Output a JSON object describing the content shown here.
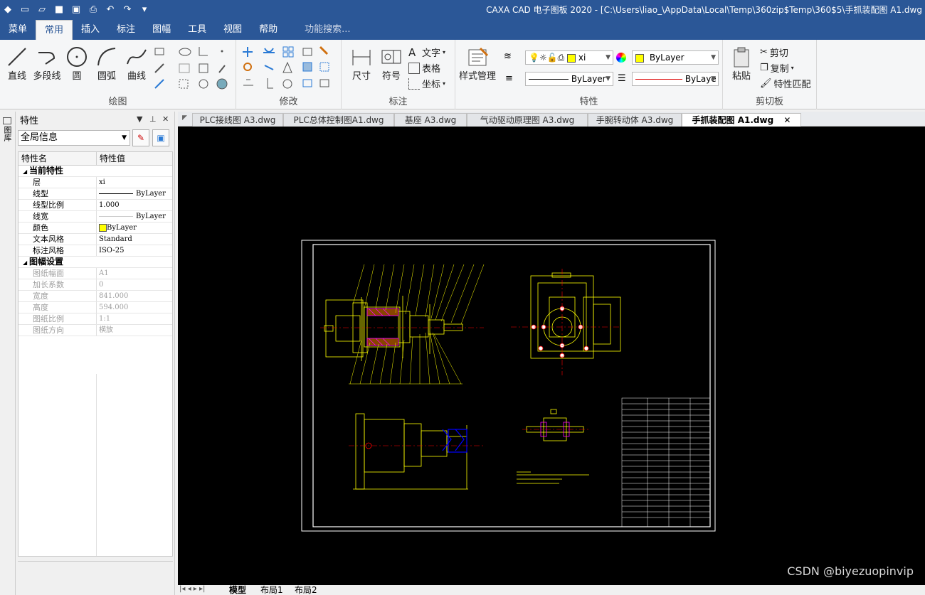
{
  "app": {
    "title": "CAXA CAD 电子图板 2020 - [C:\\Users\\liao_\\AppData\\Local\\Temp\\360zip$Temp\\360$5\\手抓装配图 A1.dwg"
  },
  "menubar": {
    "tabs": [
      "菜单",
      "常用",
      "插入",
      "标注",
      "图幅",
      "工具",
      "视图",
      "帮助"
    ],
    "active_index": 1,
    "search": "功能搜索..."
  },
  "ribbon": {
    "draw": {
      "label": "绘图",
      "line": "直线",
      "polyline": "多段线",
      "circle": "圆",
      "arc": "圆弧",
      "curve": "曲线"
    },
    "modify": {
      "label": "修改"
    },
    "annotate": {
      "label": "标注",
      "dimension": "尺寸",
      "symbol": "符号",
      "text": "文字",
      "table": "表格",
      "coord": "坐标"
    },
    "style": {
      "manager": "样式管理"
    },
    "properties": {
      "label": "特性",
      "layer": "xi",
      "color": "ByLayer",
      "linetype": "ByLayer",
      "lineweight": "ByLaye"
    },
    "clipboard": {
      "label": "剪切板",
      "paste": "粘贴",
      "cut": "剪切",
      "copy": "复制",
      "match": "特性匹配"
    }
  },
  "left_strip": {
    "label": "图库"
  },
  "panel": {
    "title": "特性",
    "selector": "全局信息",
    "columns": [
      "特性名",
      "特性值"
    ],
    "current_category": "当前特性",
    "current": [
      {
        "k": "层",
        "v": "xi"
      },
      {
        "k": "线型",
        "v": "ByLayer"
      },
      {
        "k": "线型比例",
        "v": "1.000"
      },
      {
        "k": "线宽",
        "v": "ByLayer"
      },
      {
        "k": "颜色",
        "v": "ByLayer"
      },
      {
        "k": "文本风格",
        "v": "Standard"
      },
      {
        "k": "标注风格",
        "v": "ISO-25"
      }
    ],
    "sheet_category": "图幅设置",
    "sheet": [
      {
        "k": "图纸幅面",
        "v": "A1"
      },
      {
        "k": "加长系数",
        "v": "0"
      },
      {
        "k": "宽度",
        "v": "841.000"
      },
      {
        "k": "高度",
        "v": "594.000"
      },
      {
        "k": "图纸比例",
        "v": "1:1"
      },
      {
        "k": "图纸方向",
        "v": "横放"
      }
    ]
  },
  "doc_tabs": [
    "PLC接线图 A3.dwg",
    "PLC总体控制图A1.dwg",
    "基座 A3.dwg",
    "气动驱动原理图 A3.dwg",
    "手腕转动体 A3.dwg",
    "手抓装配图 A1.dwg"
  ],
  "active_doc": 5,
  "layout_tabs": [
    "模型",
    "布局1",
    "布局2"
  ],
  "watermark": "CSDN @biyezuopinvip",
  "colors": {
    "title_bar": "#2b5797",
    "canvas": "#000000",
    "drawing_line": "#ffff00",
    "frame": "#ffffff",
    "center_line": "#ff0000",
    "hatch": "#ff00ff",
    "blue_part": "#0000ff"
  }
}
